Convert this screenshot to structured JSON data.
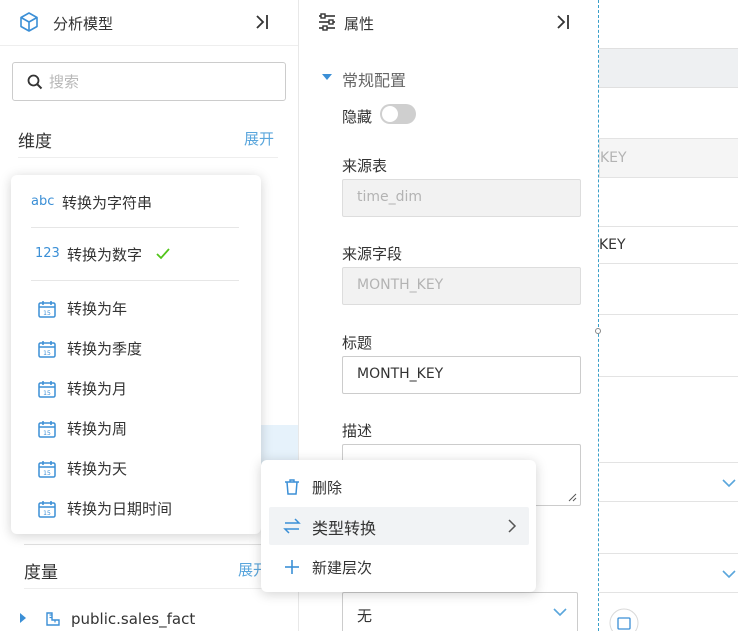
{
  "left_panel": {
    "title": "分析模型",
    "search": {
      "placeholder": "搜索",
      "value": ""
    },
    "dimension": {
      "title": "维度",
      "expand_label": "展开"
    },
    "measure": {
      "title": "度量",
      "expand_label": "展开"
    },
    "measure_items": [
      {
        "label": "public.sales_fact"
      }
    ]
  },
  "properties_panel": {
    "title": "属性",
    "group_title": "常规配置",
    "hidden": {
      "label": "隐藏",
      "on": false
    },
    "source_table": {
      "label": "来源表",
      "value": "time_dim"
    },
    "source_field": {
      "label": "来源字段",
      "value": "MONTH_KEY"
    },
    "caption": {
      "label": "标题",
      "value": "MONTH_KEY"
    },
    "description": {
      "label": "描述",
      "value": ""
    },
    "select": {
      "value": "无"
    }
  },
  "right_panel": {
    "texts": [
      "KEY",
      "KEY"
    ]
  },
  "convert_menu": {
    "items": [
      {
        "prefix": "abc",
        "label": "转换为字符串",
        "checked": false
      },
      {
        "prefix": "123",
        "label": "转换为数字",
        "checked": true
      },
      {
        "icon": "calendar-icon",
        "label": "转换为年"
      },
      {
        "icon": "calendar-icon",
        "label": "转换为季度"
      },
      {
        "icon": "calendar-icon",
        "label": "转换为月"
      },
      {
        "icon": "calendar-icon",
        "label": "转换为周"
      },
      {
        "icon": "calendar-icon",
        "label": "转换为天"
      },
      {
        "icon": "calendar-icon",
        "label": "转换为日期时间"
      }
    ]
  },
  "context_menu": {
    "items": [
      {
        "icon": "trash-icon",
        "label": "删除"
      },
      {
        "icon": "swap-icon",
        "label": "类型转换",
        "has_submenu": true,
        "active": true
      },
      {
        "icon": "plus-icon",
        "label": "新建层次"
      }
    ]
  },
  "colors": {
    "accent": "#3b8fd6",
    "link": "#5aa6dc",
    "check": "#52c41a",
    "dashed_guide": "#3a9fc9"
  }
}
